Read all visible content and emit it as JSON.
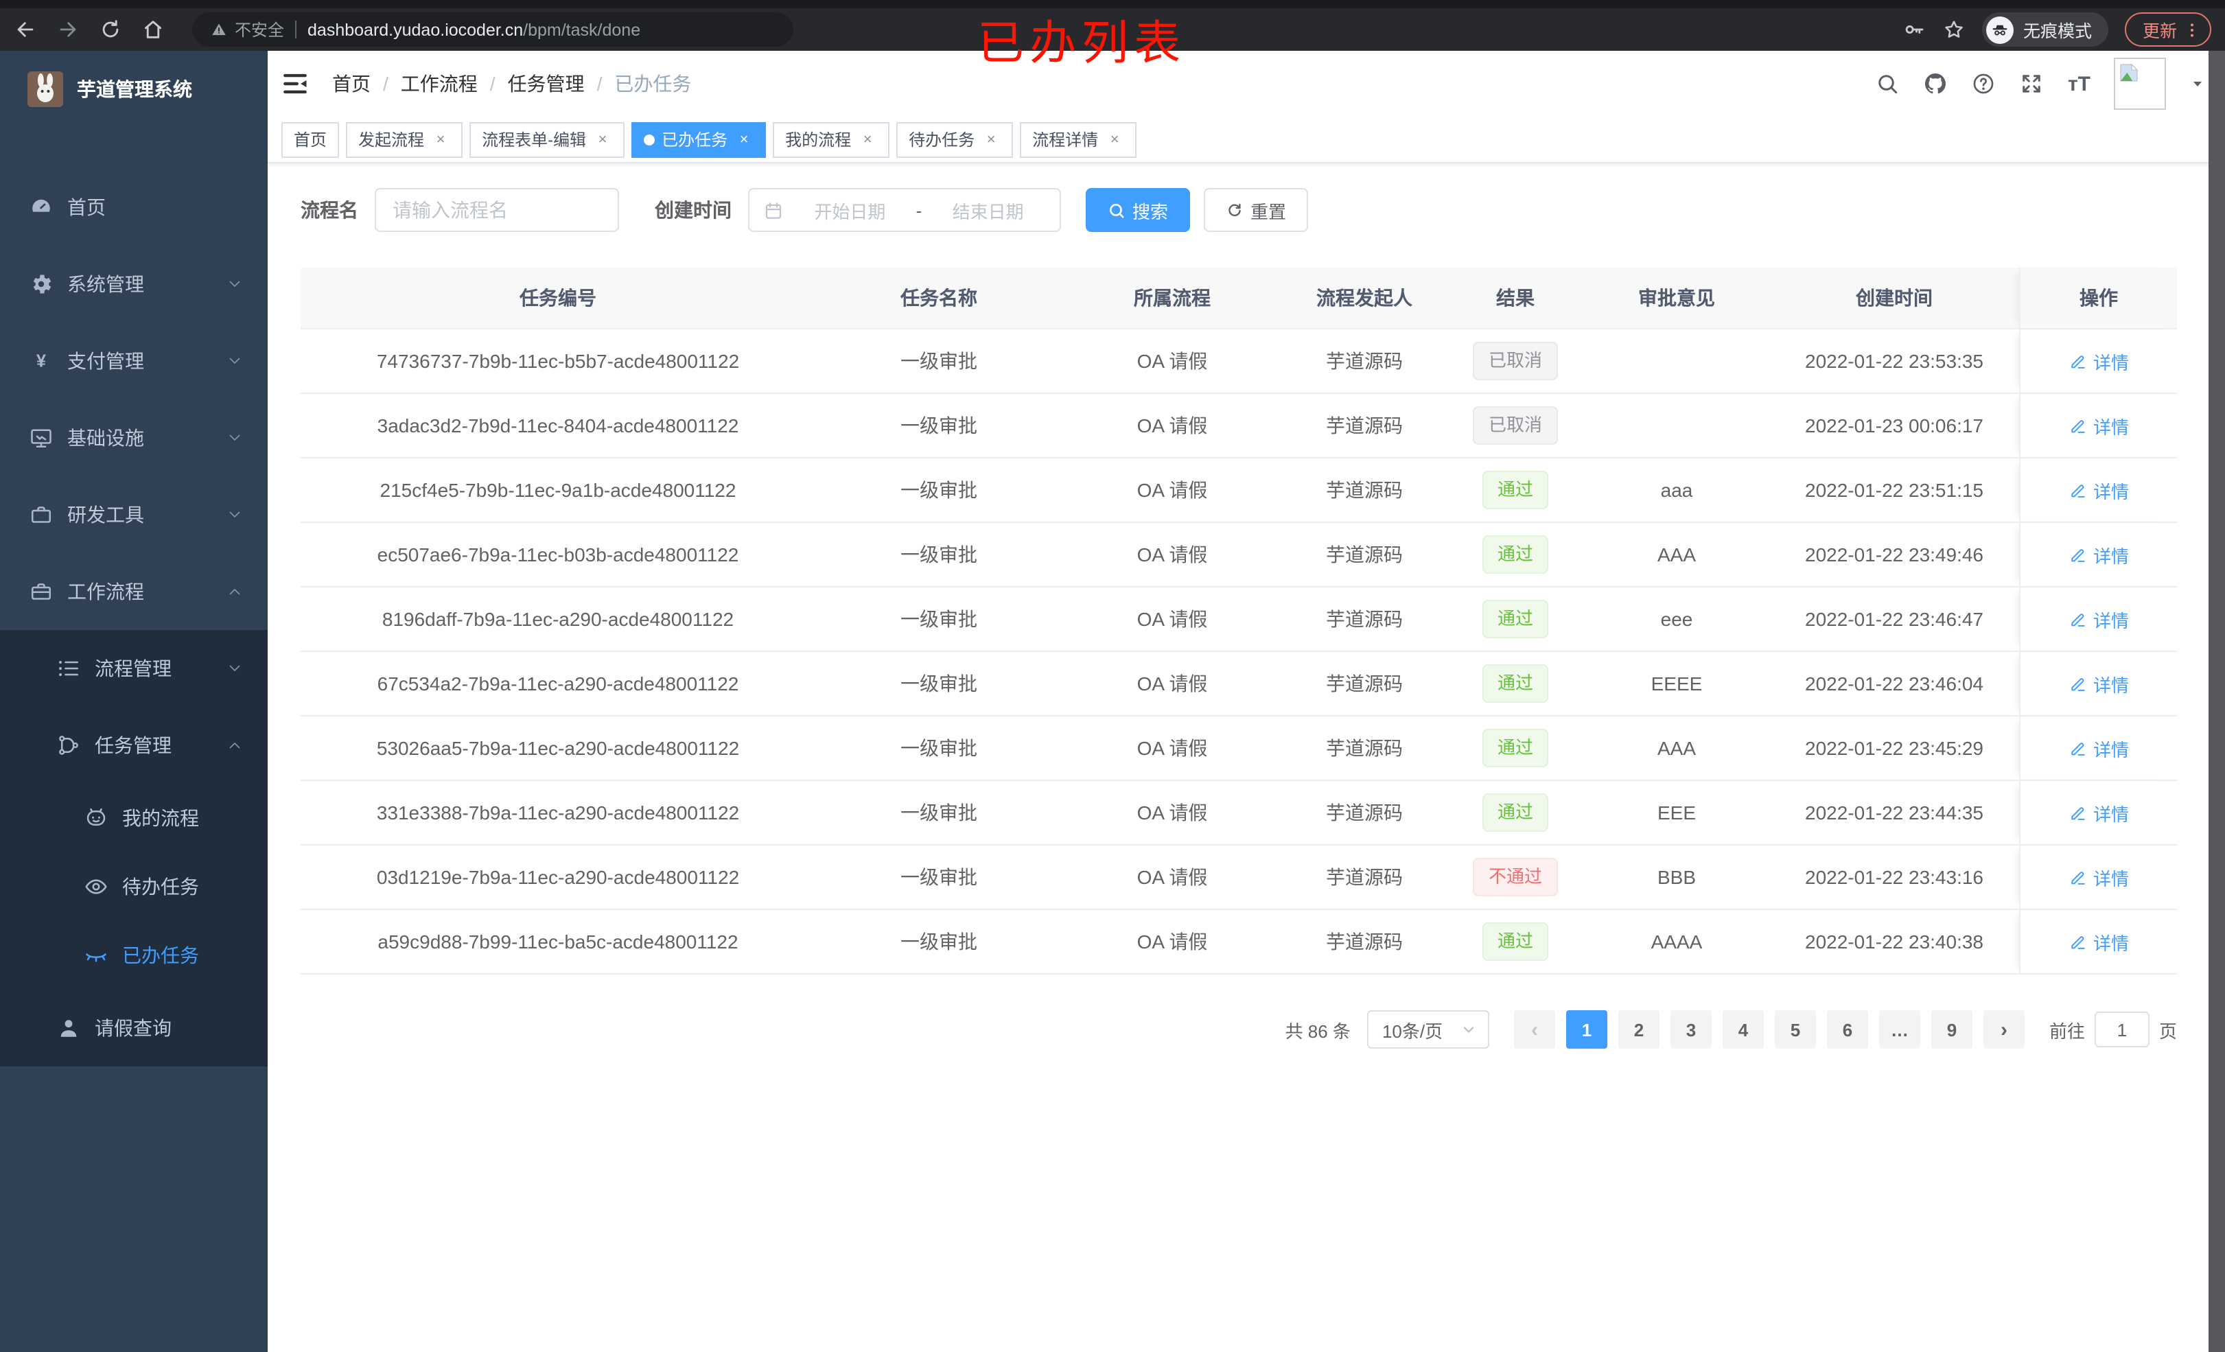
{
  "annotation": {
    "text": "已办列表",
    "color": "#FB1505"
  },
  "colors": {
    "accent": "#409EFF",
    "success": "#67C23A",
    "danger": "#F56C6C",
    "info": "#909399",
    "sidebar_bg": "#304156",
    "submenu_bg": "#1F2D3D",
    "update_chip": "#F28B82"
  },
  "browser": {
    "security_label": "不安全",
    "url_host": "dashboard.yudao.iocoder.cn",
    "url_path": "/bpm/task/done",
    "incognito_label": "无痕模式",
    "update_label": "更新"
  },
  "sidebar": {
    "app_title": "芋道管理系统",
    "items": [
      {
        "label": "首页",
        "icon": "dashboard-icon",
        "level": 1
      },
      {
        "label": "系统管理",
        "icon": "gear-icon",
        "level": 1,
        "chevron": "down"
      },
      {
        "label": "支付管理",
        "icon": "yen-icon",
        "level": 1,
        "chevron": "down"
      },
      {
        "label": "基础设施",
        "icon": "monitor-icon",
        "level": 1,
        "chevron": "down"
      },
      {
        "label": "研发工具",
        "icon": "toolbox-icon",
        "level": 1,
        "chevron": "down"
      },
      {
        "label": "工作流程",
        "icon": "briefcase-icon",
        "level": 1,
        "chevron": "up"
      },
      {
        "label": "流程管理",
        "icon": "flow-list-icon",
        "level": 2,
        "in_submenu": true,
        "chevron": "down"
      },
      {
        "label": "任务管理",
        "icon": "task-tree-icon",
        "level": 2,
        "in_submenu": true,
        "chevron": "up"
      },
      {
        "label": "我的流程",
        "icon": "my-process-icon",
        "level": 3,
        "in_submenu": true
      },
      {
        "label": "待办任务",
        "icon": "eye-open-icon",
        "level": 3,
        "in_submenu": true
      },
      {
        "label": "已办任务",
        "icon": "eye-closed-icon",
        "level": 3,
        "in_submenu": true,
        "active": true
      },
      {
        "label": "请假查询",
        "icon": "person-icon",
        "level": 2,
        "in_submenu": true
      }
    ]
  },
  "navbar": {
    "breadcrumb": [
      "首页",
      "工作流程",
      "任务管理",
      "已办任务"
    ]
  },
  "tags": [
    {
      "label": "首页",
      "closable": false,
      "active": false
    },
    {
      "label": "发起流程",
      "closable": true,
      "active": false
    },
    {
      "label": "流程表单-编辑",
      "closable": true,
      "active": false
    },
    {
      "label": "已办任务",
      "closable": true,
      "active": true
    },
    {
      "label": "我的流程",
      "closable": true,
      "active": false
    },
    {
      "label": "待办任务",
      "closable": true,
      "active": false
    },
    {
      "label": "流程详情",
      "closable": true,
      "active": false
    }
  ],
  "filter": {
    "process_name_label": "流程名",
    "process_name_placeholder": "请输入流程名",
    "create_time_label": "创建时间",
    "start_placeholder": "开始日期",
    "range_separator": "-",
    "end_placeholder": "结束日期",
    "search_label": "搜索",
    "reset_label": "重置"
  },
  "table": {
    "columns": [
      "任务编号",
      "任务名称",
      "所属流程",
      "流程发起人",
      "结果",
      "审批意见",
      "创建时间",
      "操作"
    ],
    "action_label": "详情",
    "rows": [
      {
        "id": "74736737-7b9b-11ec-b5b7-acde48001122",
        "name": "一级审批",
        "process": "OA 请假",
        "initiator": "芋道源码",
        "result": "已取消",
        "result_type": "info",
        "comment": "",
        "created": "2022-01-22 23:53:35"
      },
      {
        "id": "3adac3d2-7b9d-11ec-8404-acde48001122",
        "name": "一级审批",
        "process": "OA 请假",
        "initiator": "芋道源码",
        "result": "已取消",
        "result_type": "info",
        "comment": "",
        "created": "2022-01-23 00:06:17"
      },
      {
        "id": "215cf4e5-7b9b-11ec-9a1b-acde48001122",
        "name": "一级审批",
        "process": "OA 请假",
        "initiator": "芋道源码",
        "result": "通过",
        "result_type": "success",
        "comment": "aaa",
        "created": "2022-01-22 23:51:15"
      },
      {
        "id": "ec507ae6-7b9a-11ec-b03b-acde48001122",
        "name": "一级审批",
        "process": "OA 请假",
        "initiator": "芋道源码",
        "result": "通过",
        "result_type": "success",
        "comment": "AAA",
        "created": "2022-01-22 23:49:46"
      },
      {
        "id": "8196daff-7b9a-11ec-a290-acde48001122",
        "name": "一级审批",
        "process": "OA 请假",
        "initiator": "芋道源码",
        "result": "通过",
        "result_type": "success",
        "comment": "eee",
        "created": "2022-01-22 23:46:47"
      },
      {
        "id": "67c534a2-7b9a-11ec-a290-acde48001122",
        "name": "一级审批",
        "process": "OA 请假",
        "initiator": "芋道源码",
        "result": "通过",
        "result_type": "success",
        "comment": "EEEE",
        "created": "2022-01-22 23:46:04"
      },
      {
        "id": "53026aa5-7b9a-11ec-a290-acde48001122",
        "name": "一级审批",
        "process": "OA 请假",
        "initiator": "芋道源码",
        "result": "通过",
        "result_type": "success",
        "comment": "AAA",
        "created": "2022-01-22 23:45:29"
      },
      {
        "id": "331e3388-7b9a-11ec-a290-acde48001122",
        "name": "一级审批",
        "process": "OA 请假",
        "initiator": "芋道源码",
        "result": "通过",
        "result_type": "success",
        "comment": "EEE",
        "created": "2022-01-22 23:44:35"
      },
      {
        "id": "03d1219e-7b9a-11ec-a290-acde48001122",
        "name": "一级审批",
        "process": "OA 请假",
        "initiator": "芋道源码",
        "result": "不通过",
        "result_type": "danger",
        "comment": "BBB",
        "created": "2022-01-22 23:43:16"
      },
      {
        "id": "a59c9d88-7b99-11ec-ba5c-acde48001122",
        "name": "一级审批",
        "process": "OA 请假",
        "initiator": "芋道源码",
        "result": "通过",
        "result_type": "success",
        "comment": "AAAA",
        "created": "2022-01-22 23:40:38"
      }
    ]
  },
  "pagination": {
    "total": "共 86 条",
    "page_size": "10条/页",
    "prev": "‹",
    "next": "›",
    "pages": [
      "1",
      "2",
      "3",
      "4",
      "5",
      "6",
      "…",
      "9"
    ],
    "active_page": "1",
    "goto_prefix": "前往",
    "goto_value": "1",
    "goto_suffix": "页"
  }
}
